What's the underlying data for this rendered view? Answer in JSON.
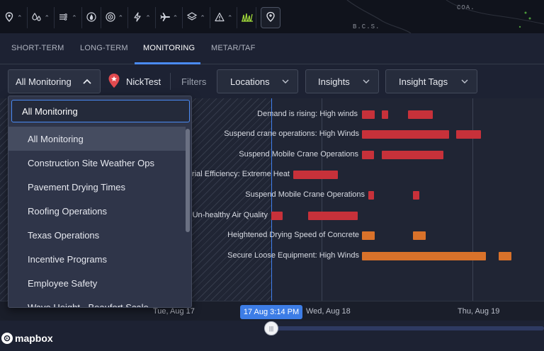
{
  "map": {
    "labels": [
      "COA.",
      "B.C.S."
    ]
  },
  "toolbar": {
    "tools": [
      {
        "icon": "location-pin-icon"
      },
      {
        "icon": "water-drops-icon"
      },
      {
        "icon": "wind-icon"
      },
      {
        "icon": "fire-icon"
      },
      {
        "icon": "radar-icon"
      },
      {
        "icon": "lightning-icon"
      },
      {
        "icon": "airplane-icon"
      },
      {
        "icon": "layers-icon"
      },
      {
        "icon": "warning-icon"
      },
      {
        "icon": "grass-icon"
      },
      {
        "icon": "add-location-icon"
      }
    ]
  },
  "tabs": [
    "SHORT-TERM",
    "LONG-TERM",
    "MONITORING",
    "METAR/TAF"
  ],
  "active_tab": "MONITORING",
  "filters": {
    "monitoring_select": "All Monitoring",
    "user": "NickTest",
    "filters_label": "Filters",
    "locations": "Locations",
    "insights": "Insights",
    "insight_tags": "Insight Tags"
  },
  "dropdown": {
    "search_value": "All Monitoring",
    "items": [
      "All Monitoring",
      "Construction Site Weather Ops",
      "Pavement Drying Times",
      "Roofing Operations",
      "Texas Operations",
      "Incentive Programs",
      "Employee Safety",
      "Wave Height - Beaufort Scale"
    ],
    "selected_index": 0
  },
  "timeline": {
    "rows": [
      {
        "label": "Demand is rising: High winds",
        "color": "#c7313a"
      },
      {
        "label": "Suspend crane operations: High Winds",
        "color": "#c7313a"
      },
      {
        "label": "Suspend Mobile Crane Operations",
        "color": "#c7313a"
      },
      {
        "label": "rial Efficiency: Extreme Heat",
        "color": "#c7313a"
      },
      {
        "label": "Suspend Mobile Crane Operations",
        "color": "#c7313a"
      },
      {
        "label": "Un-healthy Air Quality",
        "color": "#c7313a"
      },
      {
        "label": "Heightened Drying Speed of Concrete",
        "color": "#d9722a"
      },
      {
        "label": "Secure Loose Equipment: High Winds",
        "color": "#d9722a"
      }
    ],
    "axis_ticks": [
      "Tue, Aug 17",
      "Wed, Aug 18",
      "Thu, Aug 19"
    ],
    "current_time": "17 Aug 3:14 PM"
  },
  "attribution": "mapbox",
  "colors": {
    "accent": "#4a8bf5",
    "alert_red": "#c7313a",
    "alert_orange": "#d9722a"
  }
}
